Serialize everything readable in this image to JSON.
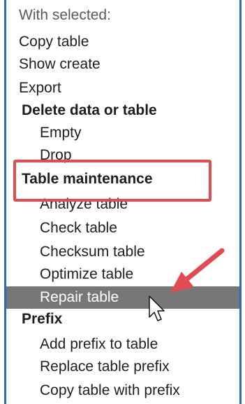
{
  "menu": {
    "header": "With selected:",
    "items": [
      "Copy table",
      "Show create",
      "Export",
      "Delete data or table",
      "Empty",
      "Drop",
      "Table maintenance",
      "Analyze table",
      "Check table",
      "Checksum table",
      "Optimize table",
      "Repair table",
      "Prefix",
      "Add prefix to table",
      "Replace table prefix",
      "Copy table with prefix"
    ]
  },
  "colors": {
    "panel_border": "#2a6ab6",
    "highlight_box": "#e24b4f",
    "arrow": "#e24b4f",
    "selected_row": "#777777"
  },
  "icons": [
    "arrow-annotation-icon",
    "mouse-cursor-icon"
  ]
}
